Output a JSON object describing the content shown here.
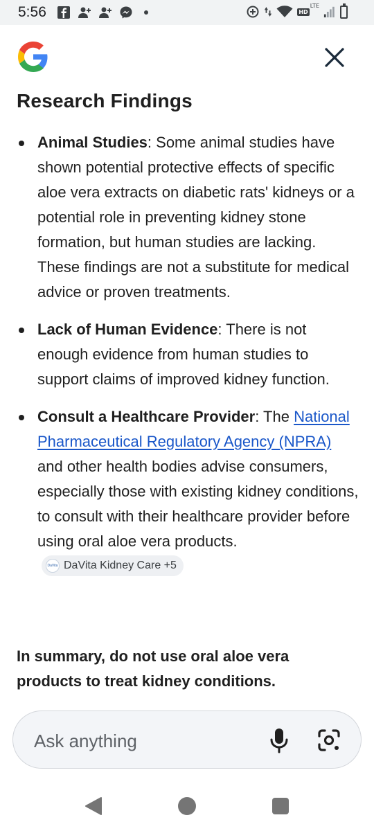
{
  "status_bar": {
    "time": "5:56",
    "left_icons": [
      "facebook-icon",
      "add-friend-icon",
      "add-friend-icon",
      "messenger-icon",
      "notification-dot"
    ],
    "right_icons": [
      "data-saver-icon",
      "data-arrows-icon",
      "wifi-icon",
      "hd-lte-icon",
      "signal-icon",
      "battery-icon"
    ],
    "hd_label": "HD",
    "lte_label": "LTE"
  },
  "header": {
    "logo": "google-g-logo",
    "close_icon": "close-icon"
  },
  "content": {
    "title": "Research Findings",
    "findings": [
      {
        "heading": "Animal Studies",
        "text": ": Some animal studies have shown potential protective effects of specific aloe vera extracts on diabetic rats' kidneys or a potential role in preventing kidney stone formation, but human studies are lacking. These findings are not a substitute for medical advice or proven treatments."
      },
      {
        "heading": "Lack of Human Evidence",
        "text": ": There is not enough evidence from human studies to support claims of improved kidney function."
      },
      {
        "heading": "Consult a Healthcare Provider",
        "text_before_link": ": The ",
        "link_text": "National Pharmaceutical Regulatory Agency (NPRA)",
        "text_after_link": " and other health bodies advise consumers, especially those with existing kidney conditions, to consult with their healthcare provider before using oral aloe vera products.",
        "source_chip": "DaVita Kidney Care +5",
        "source_logo_text": "DaVita"
      }
    ],
    "summary": "In summary, do not use oral aloe vera products to treat kidney conditions."
  },
  "ask_bar": {
    "placeholder": "Ask anything",
    "mic_icon": "microphone-icon",
    "lens_icon": "google-lens-icon"
  },
  "nav_bar": {
    "back": "back-icon",
    "home": "home-icon",
    "recents": "recents-icon"
  },
  "colors": {
    "link": "#1a57c9",
    "text": "#1f1f1f",
    "askbar_bg": "#f3f5f8",
    "statusbar_bg": "#f1f3f4"
  }
}
